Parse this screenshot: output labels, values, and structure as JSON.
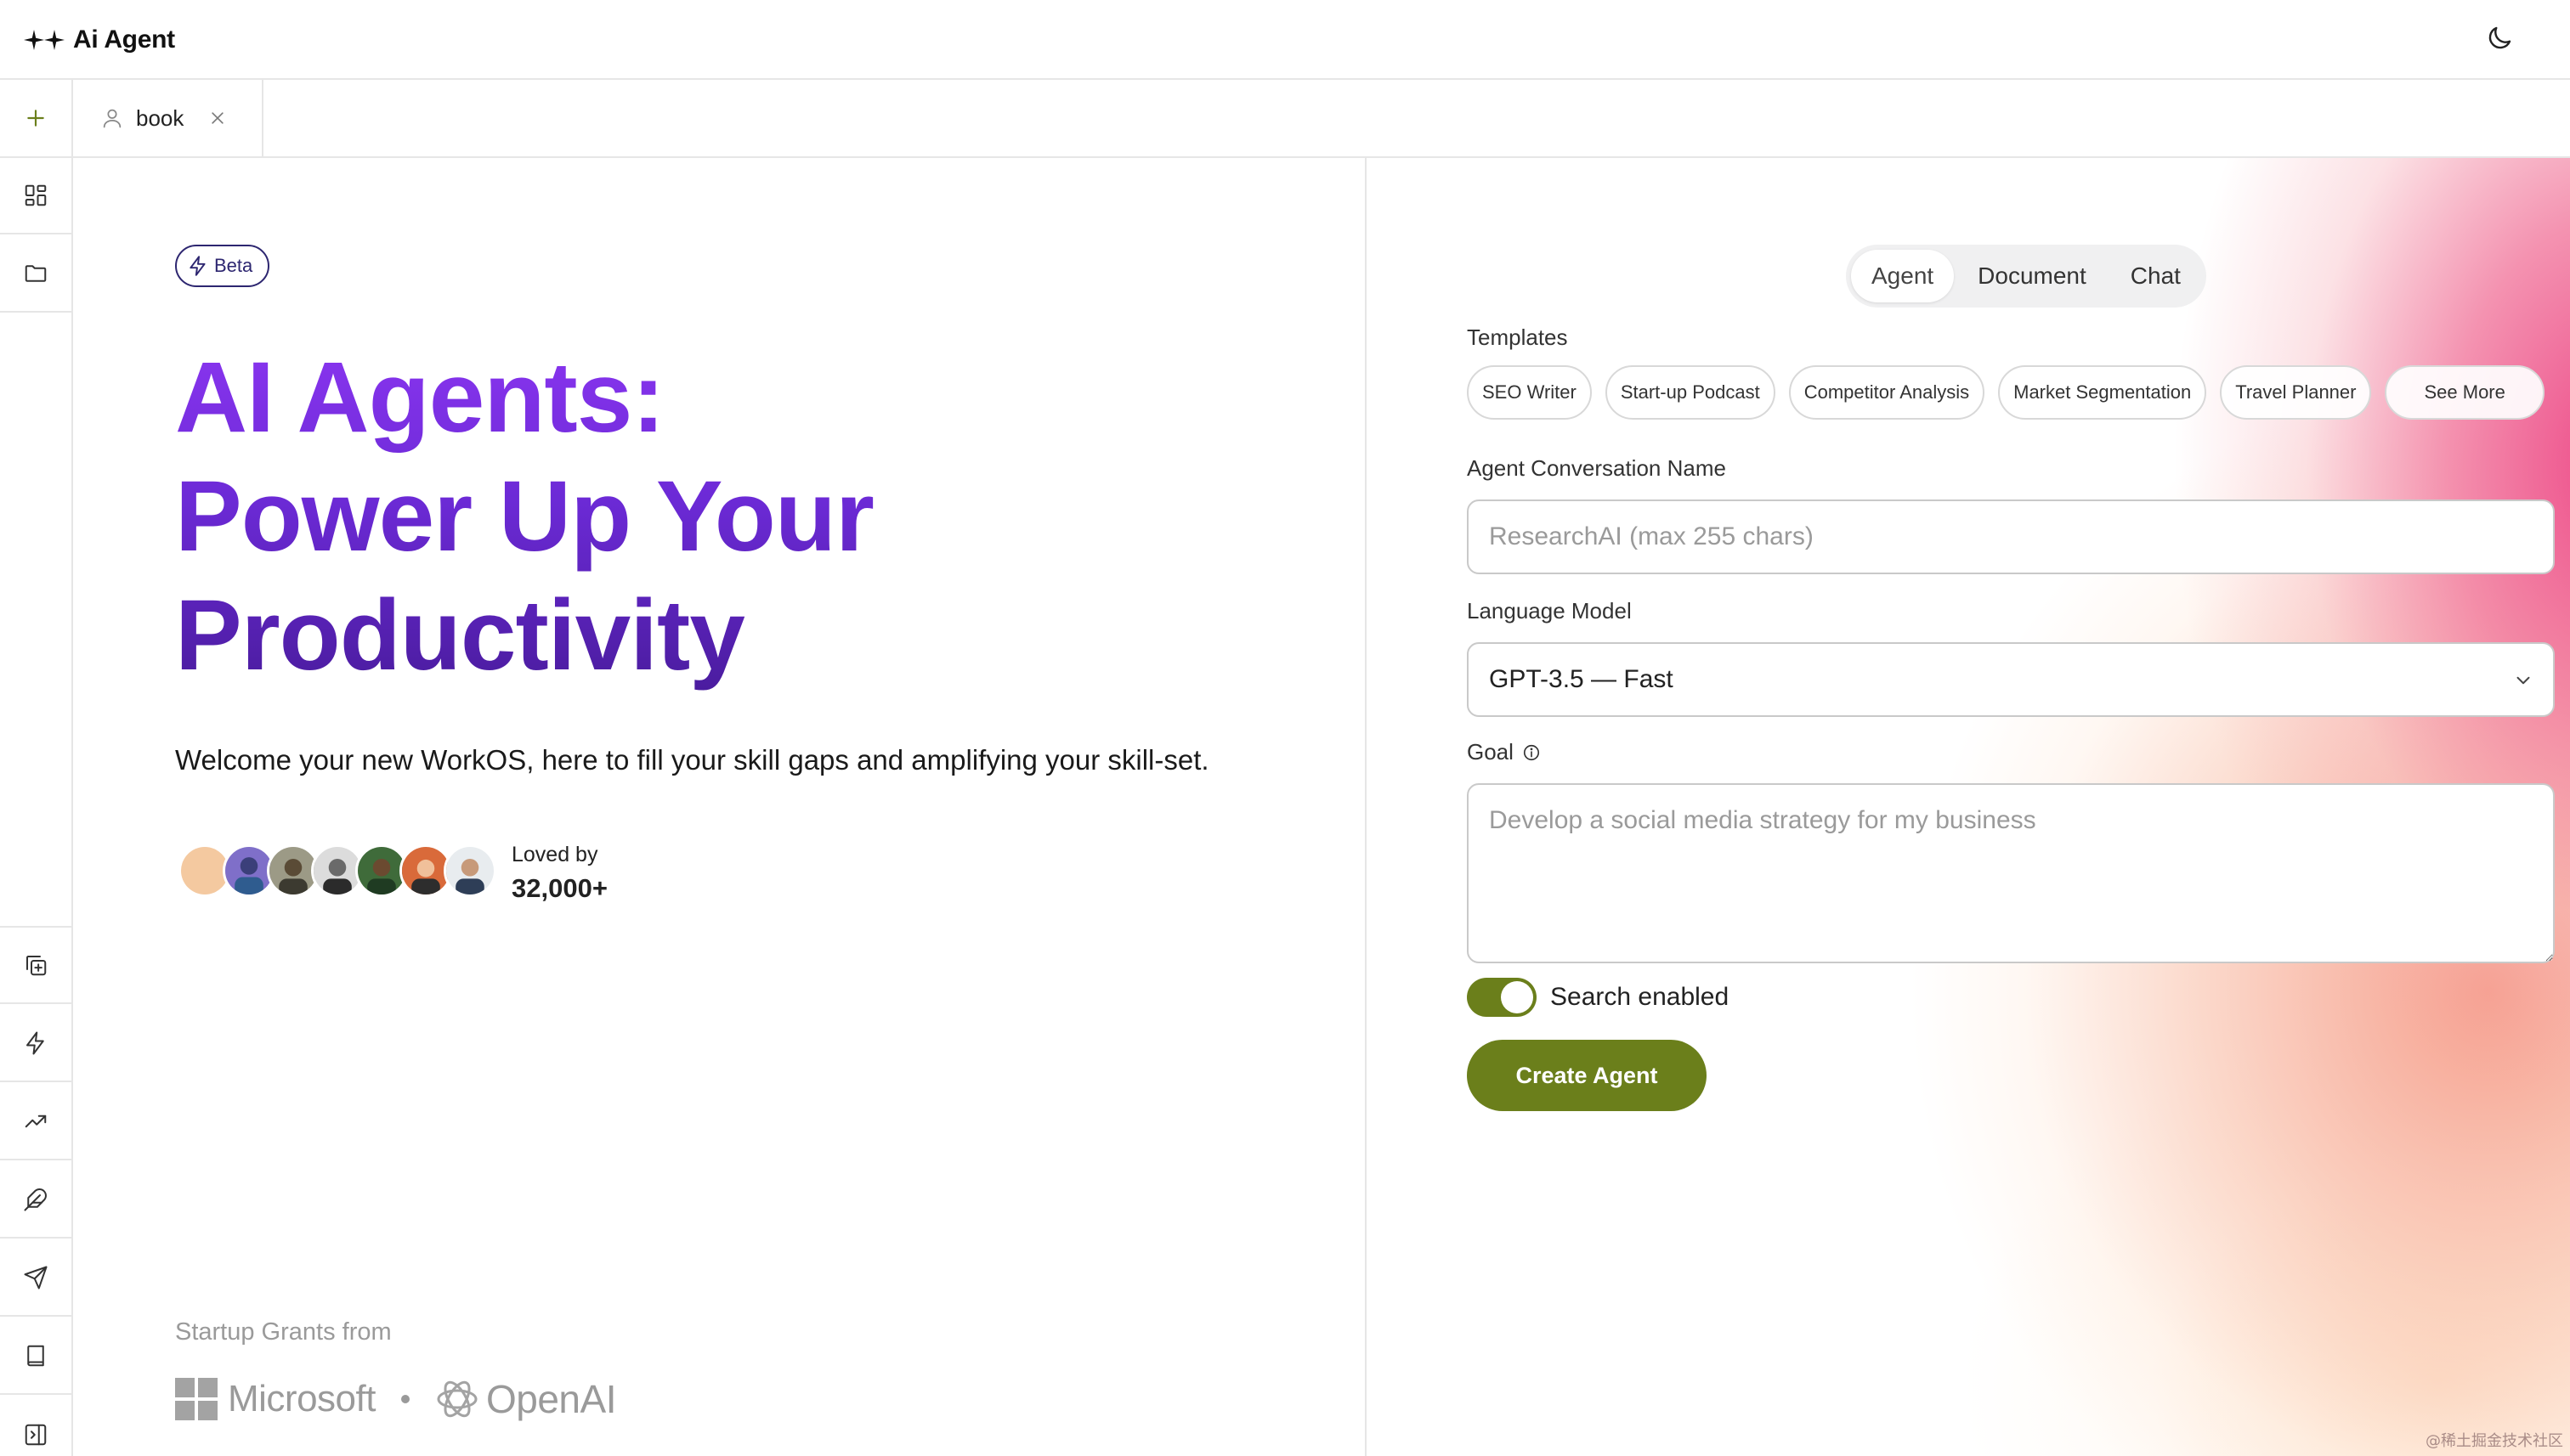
{
  "app": {
    "name": "Ai Agent",
    "theme_icon": "moon-icon"
  },
  "tabs": [
    {
      "label": "book",
      "icon": "user-icon",
      "close_icon": "close-icon"
    }
  ],
  "rail": {
    "top_items": [
      "dashboard-icon",
      "folder-icon"
    ],
    "bottom_items": [
      "copy-plus-icon",
      "zap-icon",
      "trending-up-icon",
      "feather-icon",
      "send-icon",
      "book-icon",
      "panel-toggle-icon"
    ]
  },
  "hero": {
    "badge": "Beta",
    "title_lines": [
      "AI Agents:",
      "Power Up Your",
      "Productivity"
    ],
    "subtitle": "Welcome your new WorkOS, here to fill your skill gaps and amplifying your skill-set.",
    "loved_label": "Loved by",
    "loved_count": "32,000+",
    "grants_label": "Startup Grants from",
    "partners": [
      "Microsoft",
      "OpenAI"
    ]
  },
  "form": {
    "modes": [
      "Agent",
      "Document",
      "Chat"
    ],
    "active_mode": "Agent",
    "templates_label": "Templates",
    "templates": [
      "SEO Writer",
      "Start-up Podcast",
      "Competitor Analysis",
      "Market Segmentation",
      "Travel Planner"
    ],
    "see_more": "See More",
    "name_label": "Agent Conversation Name",
    "name_placeholder": "ResearchAI (max 255 chars)",
    "model_label": "Language Model",
    "model_value": "GPT-3.5 — Fast",
    "goal_label": "Goal",
    "goal_placeholder": "Develop a social media strategy for my business",
    "search_label": "Search enabled",
    "search_enabled": true,
    "submit_label": "Create Agent"
  },
  "colors": {
    "accent_green": "#6b7f1b",
    "title_purple": "#6c2ad6",
    "beta_navy": "#2d2670"
  },
  "watermark": "@稀土掘金技术社区"
}
